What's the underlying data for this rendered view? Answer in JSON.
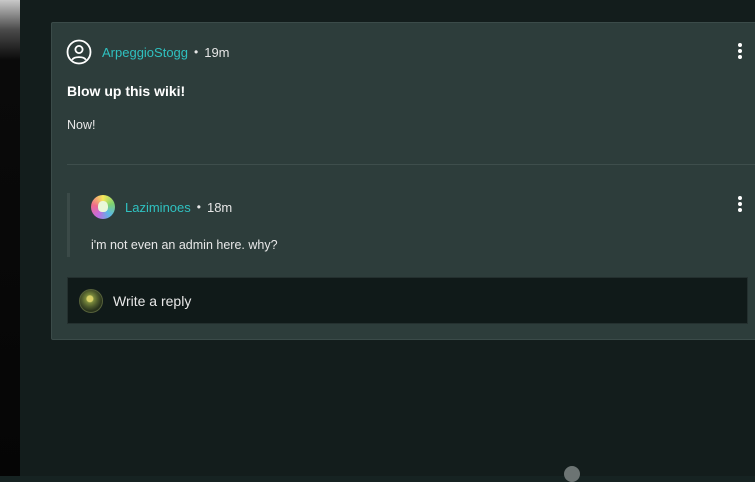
{
  "post": {
    "author": "ArpeggioStogg",
    "separator": "•",
    "time_ago": "19m",
    "title": "Blow up this wiki!",
    "body": "Now!",
    "avatar_icon": "user-circle-icon",
    "menu_icon": "more-vertical-icon"
  },
  "reply": {
    "author": "Laziminoes",
    "separator": "•",
    "time_ago": "18m",
    "body": "i'm not even an admin here. why?",
    "menu_icon": "more-vertical-icon"
  },
  "reply_input": {
    "placeholder": "Write a reply"
  },
  "colors": {
    "username": "#2fc1c0",
    "card_bg": "#2d3d3b",
    "page_bg": "#131d1c",
    "input_bg": "#101a19"
  }
}
